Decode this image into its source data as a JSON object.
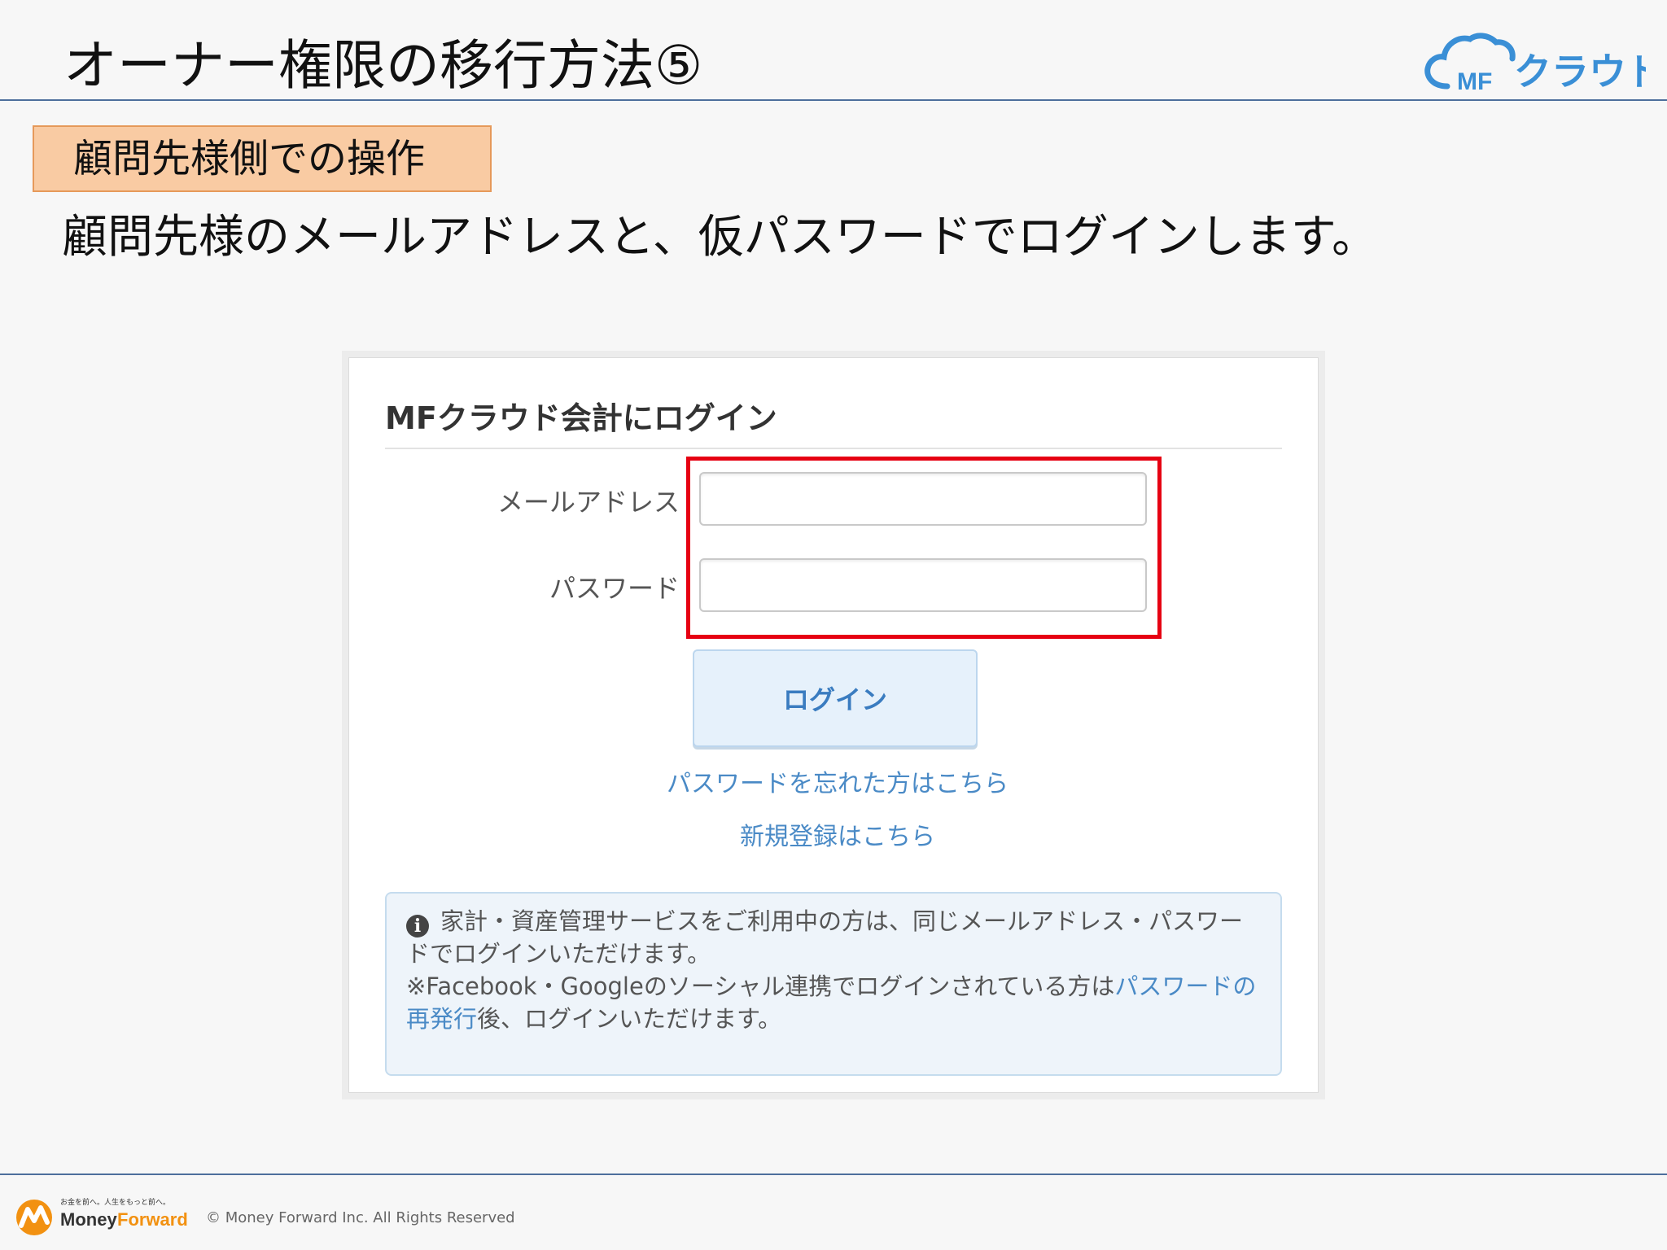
{
  "slide": {
    "title": "オーナー権限の移行方法⑤",
    "section_tag": "顧問先様側での操作",
    "instruction": "顧問先様のメールアドレスと、仮パスワードでログインします。"
  },
  "brand": {
    "logo_mf": "MF",
    "logo_text": "クラウド",
    "logo_color": "#3a8fd6"
  },
  "login": {
    "heading": "MFクラウド会計にログイン",
    "email_label": "メールアドレス",
    "email_value": "",
    "password_label": "パスワード",
    "password_value": "",
    "submit_label": "ログイン",
    "forgot_link": "パスワードを忘れた方はこちら",
    "register_link": "新規登録はこちら",
    "info_icon": "info-circle-icon",
    "info_line1": "家計・資産管理サービスをご利用中の方は、同じメールアドレス・パスワードでログインいただけます。",
    "info_line2": "※Facebook・Googleのソーシャル連携でログインされている方は",
    "info_line2_link": "パスワードの再発行",
    "info_line2_end": "後、ログインいただけます。",
    "highlight_color": "#e60012",
    "accent_color": "#4a8ac6"
  },
  "footer": {
    "logo_tagline": "お金を前へ。人生をもっと前へ。",
    "logo_money": "Money",
    "logo_forward": "Forward",
    "copyright": "© Money Forward Inc. All Rights Reserved"
  }
}
